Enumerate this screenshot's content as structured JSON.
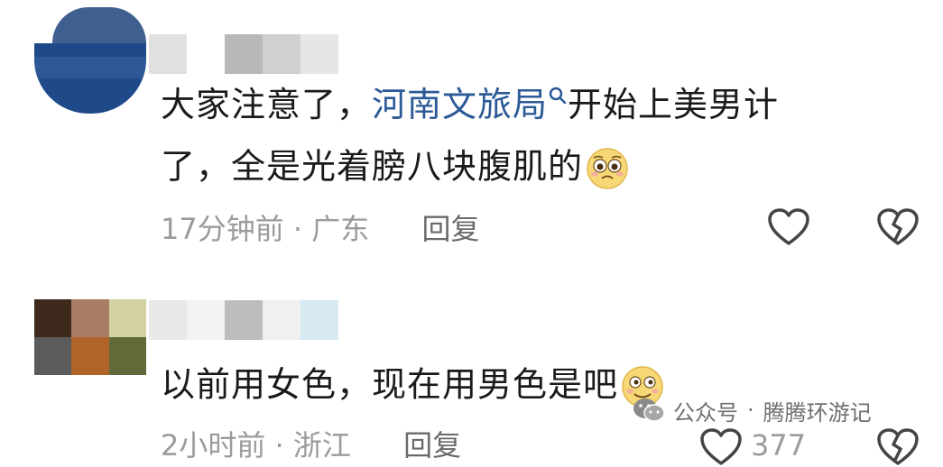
{
  "comments": [
    {
      "text_line1_before": "大家注意了，",
      "link_text": "河南文旅局",
      "text_line1_after": "开始上美男计",
      "text_line2": "了，全是光着膀八块腹肌的",
      "emoji": "pleading-face",
      "time": "17分钟前",
      "separator": "·",
      "location": "广东",
      "reply_label": "回复",
      "colors": {
        "avatar": [
          "#3f5f8f",
          "#1e4a8a",
          "#2d5898"
        ],
        "name_mosaic": [
          "#e0e0e0",
          "#ffffff",
          "#b8b8b8",
          "#d0d0d0",
          "#e6e6e6"
        ]
      }
    },
    {
      "text_line1": "以前用女色，现在用男色是吧",
      "emoji": "smirk-face",
      "time": "2小时前",
      "separator": "·",
      "location": "浙江",
      "reply_label": "回复",
      "like_count": "377",
      "colors": {
        "avatar": [
          "#3d2a1c",
          "#a97c65",
          "#d4d1a3",
          "#5b5b5b",
          "#b1642a",
          "#616b3a"
        ],
        "name_mosaic": [
          "#e8e8e8",
          "#f2f2f2",
          "#bdbdbd",
          "#f0f0f0",
          "#d8e8f2"
        ]
      }
    }
  ],
  "icons": {
    "like": "heart-outline-icon",
    "dislike": "broken-heart-outline-icon",
    "search": "search-icon"
  },
  "watermark": {
    "prefix": "公众号",
    "separator": "·",
    "name": "腾腾环游记"
  },
  "colors": {
    "link": "#2b5a97",
    "text": "#1a1a1a",
    "meta": "#9b9b9b"
  }
}
